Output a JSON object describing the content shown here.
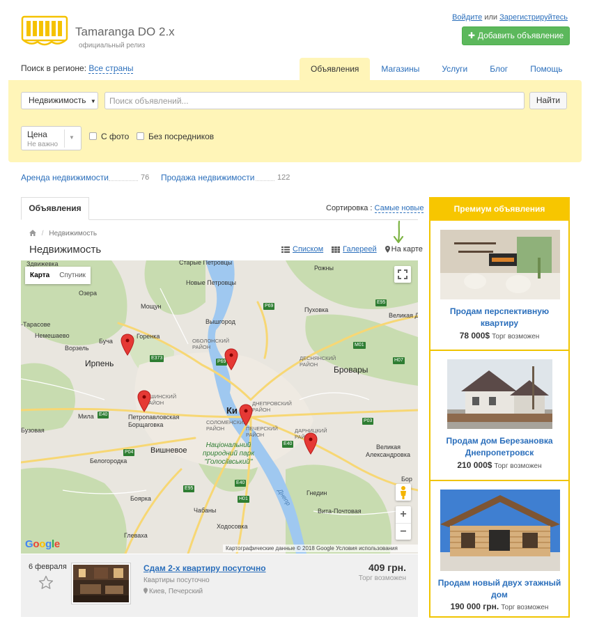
{
  "header": {
    "site_title": "Tamaranga DO 2.x",
    "site_subtitle": "официальный релиз",
    "login": "Войдите",
    "or": "или",
    "register": "Зарегистрируйтесь",
    "add_button": "Добавить объявление"
  },
  "region": {
    "label": "Поиск в регионе:",
    "value": "Все страны"
  },
  "nav": {
    "tabs": [
      "Объявления",
      "Магазины",
      "Услуги",
      "Блог",
      "Помощь"
    ],
    "active": 0
  },
  "search": {
    "category": "Недвижимость",
    "placeholder": "Поиск объявлений...",
    "find": "Найти",
    "price_label": "Цена",
    "price_value": "Не важно",
    "with_photo": "С фото",
    "no_middlemen": "Без посредников"
  },
  "categories": [
    {
      "label": "Аренда недвижимости",
      "count": "76"
    },
    {
      "label": "Продажа недвижимости",
      "count": "122"
    }
  ],
  "listing": {
    "tab": "Объявления",
    "sort_label": "Сортировка :",
    "sort_value": "Самые новые",
    "breadcrumb": "Недвижимость",
    "page_title": "Недвижимость",
    "views": {
      "list": "Списком",
      "gallery": "Галереей",
      "map": "На карте"
    }
  },
  "map": {
    "type_map": "Карта",
    "type_sat": "Спутник",
    "attribution": "Картографические данные © 2018 Google    Условия использования",
    "google": "Google",
    "labels": {
      "zdvizhevka": "Здвижевка",
      "stary_petrovtsy": "Старые Петровцы",
      "novye_petrovtsy": "Новые Петровцы",
      "rozhny": "Рожны",
      "ozera": "Озера",
      "moshchun": "Мощун",
      "tarasove": "-Тарасове",
      "nemeshaevo": "Немешаево",
      "gorenka": "Горенка",
      "vyshgorod": "Вышгород",
      "pukhovka": "Пуховка",
      "velikaya_dymerka": "Великая Дымерка",
      "bucha": "Буча",
      "vorzel": "Ворзель",
      "irpen": "Ирпень",
      "obolon": "ОБОЛОНСКИЙ РАЙОН",
      "desnyanskiy": "ДЕСНЯНСКИЙ РАЙОН",
      "brovary": "Бровары",
      "svyatoshinskiy": "ОШИНСКИЙ РАЙОН",
      "dneprovskiy": "ДНЕПРОВСКИЙ РАЙОН",
      "kiev": "Ки",
      "mila": "Мила",
      "petropavlovskaya": "Петропавловская Борщаговка",
      "solomenskiy": "СОЛОМЕНСКИЙ РАЙОН",
      "pecherskiy": "ПЕЧЕРСКИЙ РАЙОН",
      "darnitskiy": "ДАРНИЦКИЙ РАЙОН",
      "velikaya": "Великая",
      "aleksandrovka": "Александровка",
      "buzovaya": "Бузовая",
      "vishnevoe": "Вишневое",
      "park": "Національний природний парк \"Голосіївський\"",
      "bor": "Бор",
      "belogorodka": "Белогородка",
      "gnedin": "Гнедин",
      "boyarka": "Боярка",
      "vita_pochtovaya": "Вита-Почтовая",
      "chabany": "Чабаны",
      "hodosovka": "Ходосовка",
      "glevaha": "Глеваха",
      "dnepr": "Днепр"
    },
    "roads": [
      "E95",
      "P69",
      "M01",
      "H07",
      "E373",
      "P69",
      "P03",
      "E40",
      "E40",
      "P04",
      "E40",
      "E95",
      "H01"
    ]
  },
  "item": {
    "date": "6 февраля",
    "title": "Сдам 2-х квартиру посуточно",
    "category": "Квартиры посуточно",
    "location": "Киев, Печерский",
    "price": "409 грн.",
    "torg": "Торг возможен"
  },
  "premium": {
    "title": "Премиум объявления",
    "items": [
      {
        "title": "Продам перспективную квартиру",
        "price": "78 000$",
        "torg": "Торг возможен"
      },
      {
        "title": "Продам дом Березановка Днепропетровск",
        "price": "210 000$",
        "torg": "Торг возможен"
      },
      {
        "title": "Продам новый двух этажный дом",
        "price": "190 000 грн.",
        "torg": "Торг возможен"
      }
    ]
  },
  "colors": {
    "accent_yellow": "#f7c600",
    "panel_yellow": "#fff5b8",
    "link_blue": "#2a6ebb",
    "green_button": "#5cb85c",
    "marker_red": "#e53935"
  }
}
